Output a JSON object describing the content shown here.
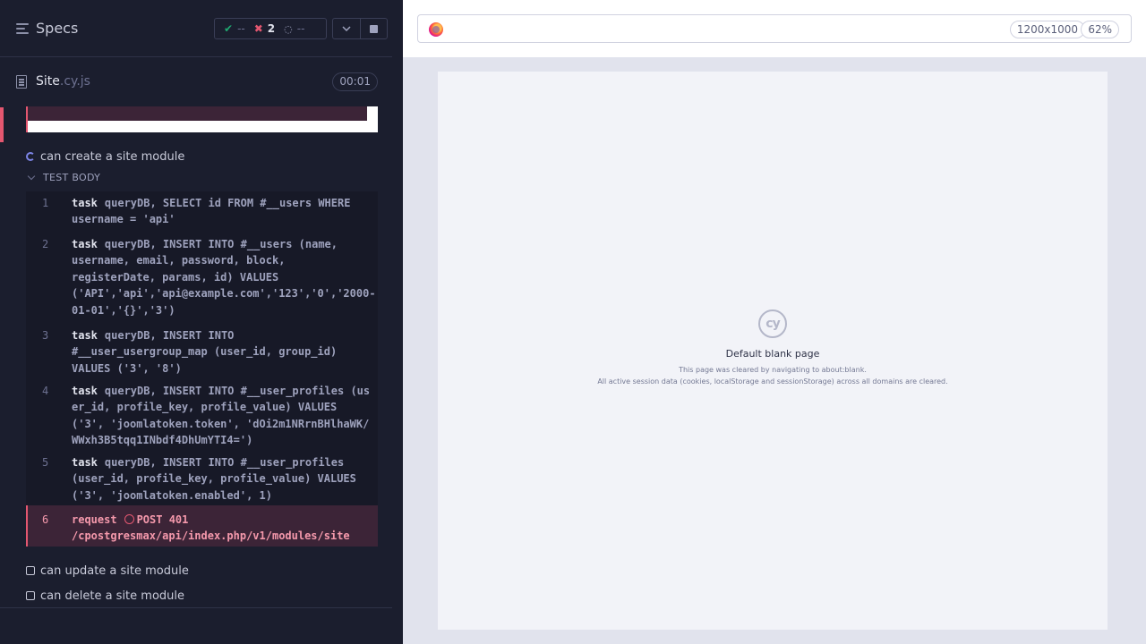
{
  "reporter": {
    "title": "Specs",
    "stats": {
      "passed": "--",
      "failed": "2",
      "pending": "--"
    },
    "file": {
      "name": "Site",
      "ext": ".cy.js",
      "duration": "00:01"
    },
    "tests": [
      {
        "title": "can create a site module",
        "state": "running"
      },
      {
        "title": "can update a site module",
        "state": "queued"
      },
      {
        "title": "can delete a site module",
        "state": "queued"
      }
    ],
    "test_body_label": "TEST BODY",
    "commands": [
      {
        "num": "1",
        "name": "task",
        "message": "queryDB, SELECT id FROM #__users WHERE username = 'api'"
      },
      {
        "num": "2",
        "name": "task",
        "message": "queryDB, INSERT INTO #__users (name, username, email, password, block, registerDate, params, id) VALUES ('API','api','api@example.com','123','0','2000-01-01','{}','3')"
      },
      {
        "num": "3",
        "name": "task",
        "message": "queryDB, INSERT INTO #__user_usergroup_map (user_id, group_id) VALUES ('3', '8')"
      },
      {
        "num": "4",
        "name": "task",
        "message": "queryDB, INSERT INTO #__user_profiles (user_id, profile_key, profile_value) VALUES ('3', 'joomlatoken.token', 'dOi2m1NRrnBHlhaWK/WWxh3B5tqq1INbdf4DhUmYTI4=')"
      },
      {
        "num": "5",
        "name": "task",
        "message": "queryDB, INSERT INTO #__user_profiles (user_id, profile_key, profile_value) VALUES ('3', 'joomlatoken.enabled', 1)"
      },
      {
        "num": "6",
        "name": "request",
        "message": "POST 401 /cpostgresmax/api/index.php/v1/modules/site",
        "state": "failed"
      }
    ]
  },
  "aut": {
    "viewport": "1200x1000",
    "zoom": "62%",
    "blank": {
      "logo": "cy",
      "title": "Default blank page",
      "line1": "This page was cleared by navigating to about:blank.",
      "line2": "All active session data (cookies, localStorage and sessionStorage) across all domains are cleared."
    }
  },
  "colors": {
    "fail": "#e45770",
    "pass": "#1fa971",
    "running": "#7c84e6",
    "panel_bg": "#1b1e2e"
  },
  "icons": [
    "specs-menu-icon",
    "check-icon",
    "x-icon",
    "pending-spinner-icon",
    "chevron-down-icon",
    "stop-icon",
    "file-icon",
    "firefox-icon",
    "cypress-logo-icon"
  ]
}
